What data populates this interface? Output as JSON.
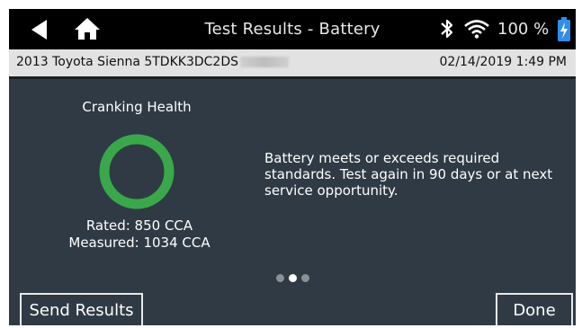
{
  "header": {
    "title": "Test Results - Battery",
    "battery_percent": "100 %",
    "icons": [
      "back-arrow-icon",
      "home-icon",
      "bluetooth-icon",
      "wifi-icon",
      "battery-charging-icon"
    ]
  },
  "vehicle": {
    "description": "2013 Toyota Sienna  5TDKK3DC2DS",
    "datetime": "02/14/2019 1:49 PM"
  },
  "result": {
    "label": "Cranking Health",
    "rated": "Rated:  850 CCA",
    "measured": "Measured:  1034 CCA",
    "message": "Battery meets or exceeds required standards. Test again in 90 days or at next service opportunity.",
    "status_color": "#3aa84a"
  },
  "pager": {
    "pages": 3,
    "current": 2
  },
  "actions": {
    "send_label": "Send Results",
    "done_label": "Done"
  }
}
